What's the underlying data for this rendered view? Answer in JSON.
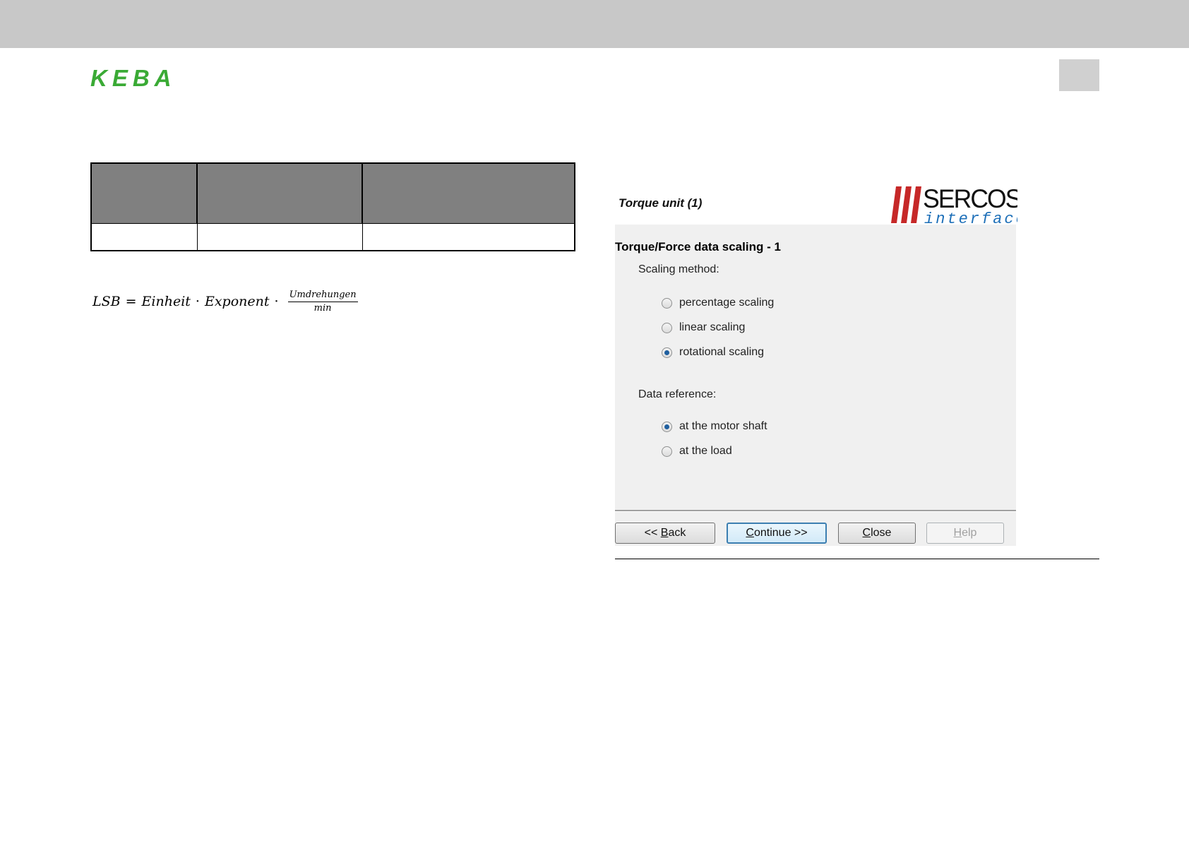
{
  "header": {
    "logo_text": "KEBA",
    "logo_color": "#3aaa35"
  },
  "table": {
    "header_color": "#808080",
    "columns": [
      "",
      "",
      ""
    ],
    "rows": [
      [
        "",
        "",
        ""
      ]
    ]
  },
  "formula": {
    "lhs": "LSB",
    "equals": "=",
    "term1": "Einheit",
    "dot": "·",
    "term2": "Exponent",
    "frac_num": "Umdrehungen",
    "frac_den": "min"
  },
  "dialog": {
    "title": "Torque unit (1)",
    "logo_text_top": "SERCOS",
    "logo_text_bottom": "interface",
    "logo_color": "#c62828",
    "section_title": "Torque/Force data scaling - 1",
    "scaling_label": "Scaling method:",
    "scaling_options": [
      {
        "label": "percentage scaling",
        "checked": false
      },
      {
        "label": "linear scaling",
        "checked": false
      },
      {
        "label": "rotational scaling",
        "checked": true
      }
    ],
    "reference_label": "Data reference:",
    "reference_options": [
      {
        "label": "at the motor shaft",
        "checked": true
      },
      {
        "label": "at the load",
        "checked": false
      }
    ],
    "buttons": {
      "back_prefix": "<< ",
      "back_key": "B",
      "back_rest": "ack",
      "continue_key": "C",
      "continue_rest": "ontinue >>",
      "close_key": "C",
      "close_rest": "lose",
      "help_key": "H",
      "help_rest": "elp",
      "help_enabled": false
    }
  }
}
